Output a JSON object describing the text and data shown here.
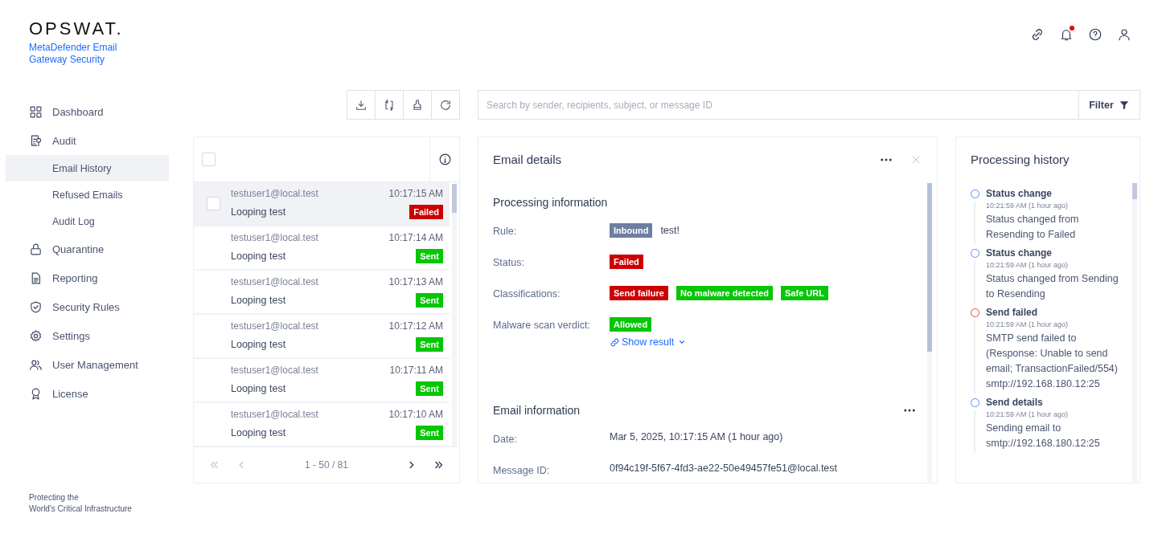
{
  "brand": {
    "logo": "OPSWAT.",
    "product": "MetaDefender Email Gateway Security"
  },
  "header": {
    "icons": [
      {
        "kind": "link"
      },
      {
        "kind": "bell"
      },
      {
        "kind": "help"
      },
      {
        "kind": "user"
      }
    ],
    "notifications_unread": true
  },
  "sidebar": {
    "items": [
      {
        "label": "Dashboard",
        "selected": false
      },
      {
        "label": "Audit",
        "selected": false,
        "children": [
          {
            "label": "Email History",
            "selected": true
          },
          {
            "label": "Refused Emails",
            "selected": false
          },
          {
            "label": "Audit Log",
            "selected": false
          }
        ]
      },
      {
        "label": "Quarantine",
        "selected": false
      },
      {
        "label": "Reporting",
        "selected": false
      },
      {
        "label": "Security Rules",
        "selected": false
      },
      {
        "label": "Settings",
        "selected": false
      },
      {
        "label": "User Management",
        "selected": false
      },
      {
        "label": "License",
        "selected": false
      }
    ],
    "footer": [
      "Protecting the",
      "World's Critical Infrastructure"
    ]
  },
  "toolbar": {
    "buttons": [
      {
        "kind": "download"
      },
      {
        "kind": "resend"
      },
      {
        "kind": "clean"
      },
      {
        "kind": "refresh"
      }
    ]
  },
  "search": {
    "placeholder": "Search by sender, recipients, subject, or message ID",
    "filter_label": "Filter"
  },
  "email_list": {
    "select_all_checked": false,
    "rows": [
      {
        "sender": "testuser1@local.test",
        "time": "10:17:15 AM",
        "subject": "Looping test",
        "status": "Failed",
        "kind": "failed",
        "selected": true
      },
      {
        "sender": "testuser1@local.test",
        "time": "10:17:14 AM",
        "subject": "Looping test",
        "status": "Sent",
        "kind": "ok",
        "selected": false
      },
      {
        "sender": "testuser1@local.test",
        "time": "10:17:13 AM",
        "subject": "Looping test",
        "status": "Sent",
        "kind": "ok",
        "selected": false
      },
      {
        "sender": "testuser1@local.test",
        "time": "10:17:12 AM",
        "subject": "Looping test",
        "status": "Sent",
        "kind": "ok",
        "selected": false
      },
      {
        "sender": "testuser1@local.test",
        "time": "10:17:11 AM",
        "subject": "Looping test",
        "status": "Sent",
        "kind": "ok",
        "selected": false
      },
      {
        "sender": "testuser1@local.test",
        "time": "10:17:10 AM",
        "subject": "Looping test",
        "status": "Sent",
        "kind": "ok",
        "selected": false
      }
    ],
    "pagination": {
      "range": "1 - 50 / 81",
      "first_disabled": true,
      "prev_disabled": true
    }
  },
  "details": {
    "title": "Email details",
    "sections": [
      {
        "title": "Processing information",
        "fields": [
          {
            "label": "Rule:",
            "tags": [
              {
                "text": "Inbound",
                "kind": "rule"
              }
            ],
            "value": "test!"
          },
          {
            "label": "Status:",
            "tags": [
              {
                "text": "Failed",
                "kind": "failed"
              }
            ]
          },
          {
            "label": "Classifications:",
            "tags": [
              {
                "text": "Send failure",
                "kind": "failed"
              },
              {
                "text": "No malware detected",
                "kind": "ok"
              },
              {
                "text": "Safe URL",
                "kind": "ok"
              }
            ]
          },
          {
            "label": "Malware scan verdict:",
            "tags": [
              {
                "text": "Allowed",
                "kind": "ok"
              }
            ],
            "link": "Show result"
          }
        ]
      },
      {
        "title": "Email information",
        "has_menu": true,
        "fields": [
          {
            "label": "Date:",
            "value": "Mar 5, 2025, 10:17:15 AM (1 hour ago)"
          },
          {
            "label": "Message ID:",
            "value": "0f94c19f-5f67-4fd3-ae22-50e49457fe51@local.test"
          }
        ]
      }
    ]
  },
  "history": {
    "title": "Processing history",
    "events": [
      {
        "title": "Status change",
        "time": "10:21:59 AM (1 hour ago)",
        "text": "Status changed from Resending to Failed",
        "kind": "info"
      },
      {
        "title": "Status change",
        "time": "10:21:59 AM (1 hour ago)",
        "text": "Status changed from Sending to Resending",
        "kind": "info"
      },
      {
        "title": "Send failed",
        "time": "10:21:59 AM (1 hour ago)",
        "text": "SMTP send failed to (Response: Unable to send email; TransactionFailed/554) smtp://192.168.180.12:25",
        "kind": "error"
      },
      {
        "title": "Send details",
        "time": "10:21:59 AM (1 hour ago)",
        "text": "Sending email to smtp://192.168.180.12:25",
        "kind": "info"
      }
    ]
  }
}
